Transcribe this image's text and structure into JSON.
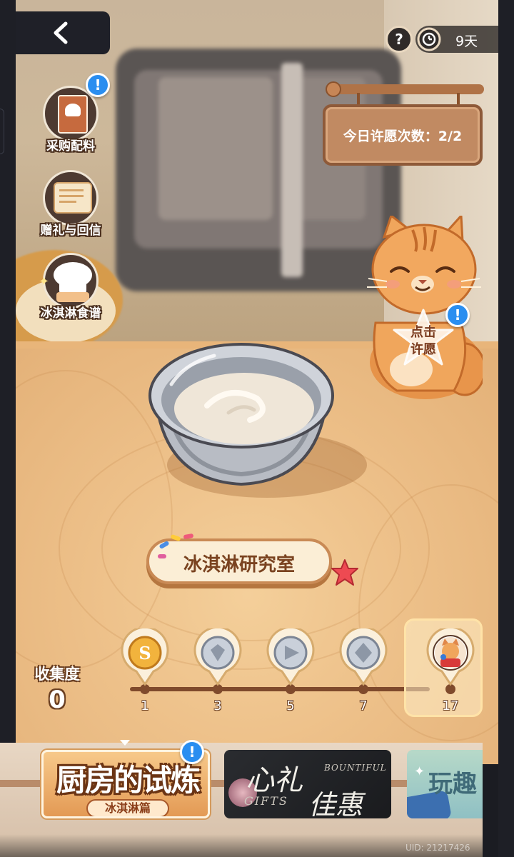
{
  "header": {
    "help_label": "?",
    "timer_label": "9天"
  },
  "side_menu": [
    {
      "label": "采购配料",
      "icon": "recipe-book-icon",
      "badge": "!"
    },
    {
      "label": "赠礼与回信",
      "icon": "letter-icon",
      "badge": ""
    },
    {
      "label": "冰淇淋食谱",
      "icon": "chef-hat-icon",
      "badge": ""
    }
  ],
  "wish_board": {
    "text": "今日许愿次数：2/2"
  },
  "wish_button": {
    "line1": "点击",
    "line2": "许愿",
    "badge": "!"
  },
  "lab": {
    "label": "冰淇淋研究室"
  },
  "collection": {
    "label": "收集度",
    "value": "0",
    "milestones": [
      {
        "threshold": "1",
        "reward": "gold-coin-icon"
      },
      {
        "threshold": "3",
        "reward": "silver-coin-icon"
      },
      {
        "threshold": "5",
        "reward": "silver-coin-icon"
      },
      {
        "threshold": "7",
        "reward": "silver-coin-icon"
      },
      {
        "threshold": "17",
        "reward": "cat-avatar-icon"
      }
    ]
  },
  "banners": [
    {
      "title": "厨房的试炼",
      "subtitle": "冰淇淋篇",
      "badge": "!"
    },
    {
      "title": "心礼",
      "title2": "佳惠",
      "en1": "BOUNTIFUL",
      "en2": "GIFTS"
    },
    {
      "title": "玩趣"
    }
  ],
  "footer": {
    "uid": "UID: 21217426"
  },
  "colors": {
    "badge_blue": "#2a8ef0",
    "wood_dark": "#7f4a2c",
    "board": "#c18a62"
  }
}
